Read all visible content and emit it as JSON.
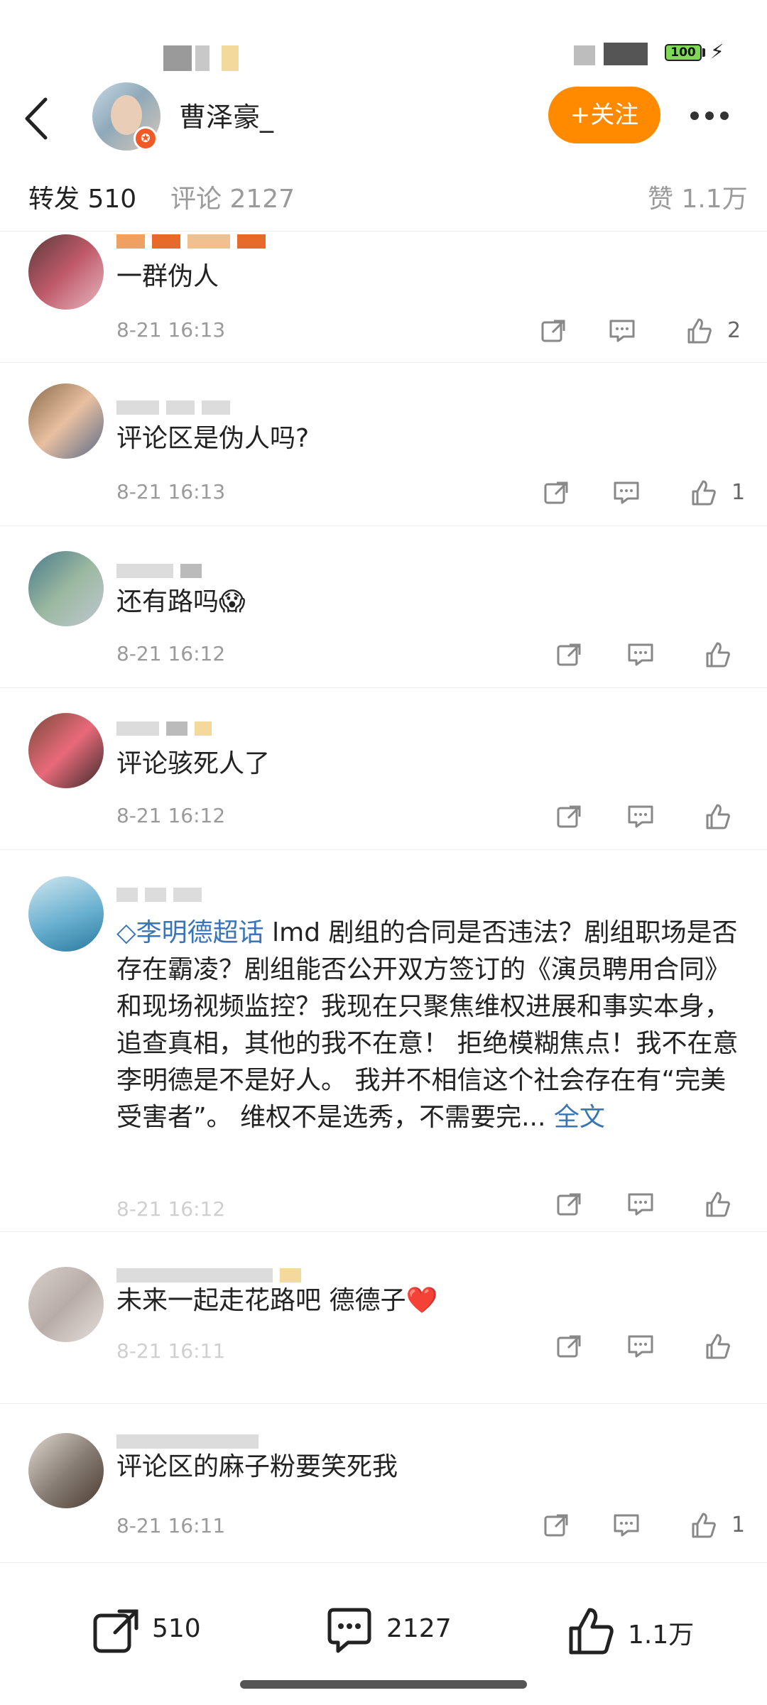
{
  "status_bar": {
    "battery": "100"
  },
  "header": {
    "user_name": "曹泽豪_",
    "follow_label": "+关注"
  },
  "tabs": {
    "repost": "转发 510",
    "comments": "评论 2127",
    "likes": "赞 1.1万"
  },
  "comments": [
    {
      "text": "一群伪人",
      "time": "8-21 16:13",
      "like_count": "2"
    },
    {
      "text": "评论区是伪人吗?",
      "time": "8-21 16:13",
      "like_count": "1"
    },
    {
      "text": "还有路吗😱",
      "time": "8-21 16:12",
      "like_count": ""
    },
    {
      "text": "评论骇死人了",
      "time": "8-21 16:12",
      "like_count": ""
    },
    {
      "topic": "◇李明德超话",
      "text": " lmd  剧组的合同是否违法？剧组职场是否存在霸凌？剧组能否公开双方签订的《演员聘用合同》和现场视频监控？我现在只聚焦维权进展和事实本身，追查真相，其他的我不在意！ 拒绝模糊焦点！我不在意李明德是不是好人。 我并不相信这个社会存在有“完美受害者”。 维权不是选秀，不需要完...",
      "more": "全文",
      "time": "8-21 16:12",
      "like_count": ""
    },
    {
      "text": "未来一起走花路吧  德德子❤️",
      "time": "8-21 16:11",
      "like_count": ""
    },
    {
      "text": "评论区的麻子粉要笑死我",
      "time": "8-21 16:11",
      "like_count": "1"
    }
  ],
  "bottom_bar": {
    "repost_count": "510",
    "comment_count": "2127",
    "like_count": "1.1万"
  }
}
